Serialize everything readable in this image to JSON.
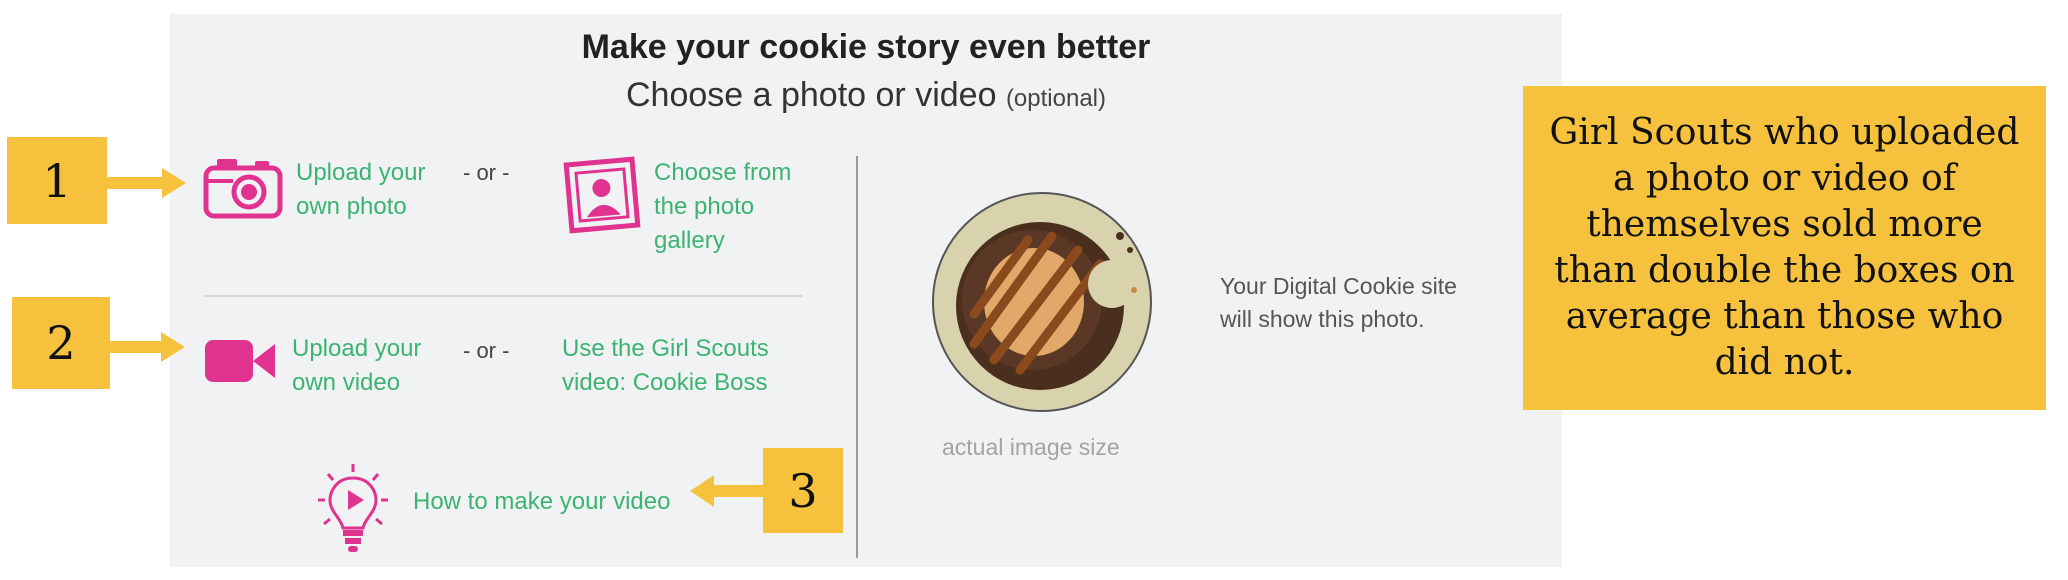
{
  "header": {
    "title": "Make your cookie story even better",
    "subtitle": "Choose a photo or video",
    "subtitle_optional": "(optional)"
  },
  "photo_row": {
    "upload_label": "Upload your own photo",
    "or": "- or -",
    "gallery_label": "Choose from the photo gallery"
  },
  "video_row": {
    "upload_label": "Upload your own video",
    "or": "- or -",
    "boss_label": "Use the Girl Scouts video: Cookie Boss"
  },
  "howto": {
    "label": "How to make your video"
  },
  "preview": {
    "site_text": "Your Digital Cookie site will show this photo.",
    "size_text": "actual image size"
  },
  "callouts": {
    "one": "1",
    "two": "2",
    "three": "3"
  },
  "note": {
    "text": "Girl Scouts who uploaded a photo or video of themselves sold more than double the boxes on average than those who did not."
  },
  "colors": {
    "accent_green": "#3cb371",
    "icon_pink": "#e0338f",
    "callout_yellow": "#f6c23e",
    "panel_bg": "#f1f2f4"
  }
}
